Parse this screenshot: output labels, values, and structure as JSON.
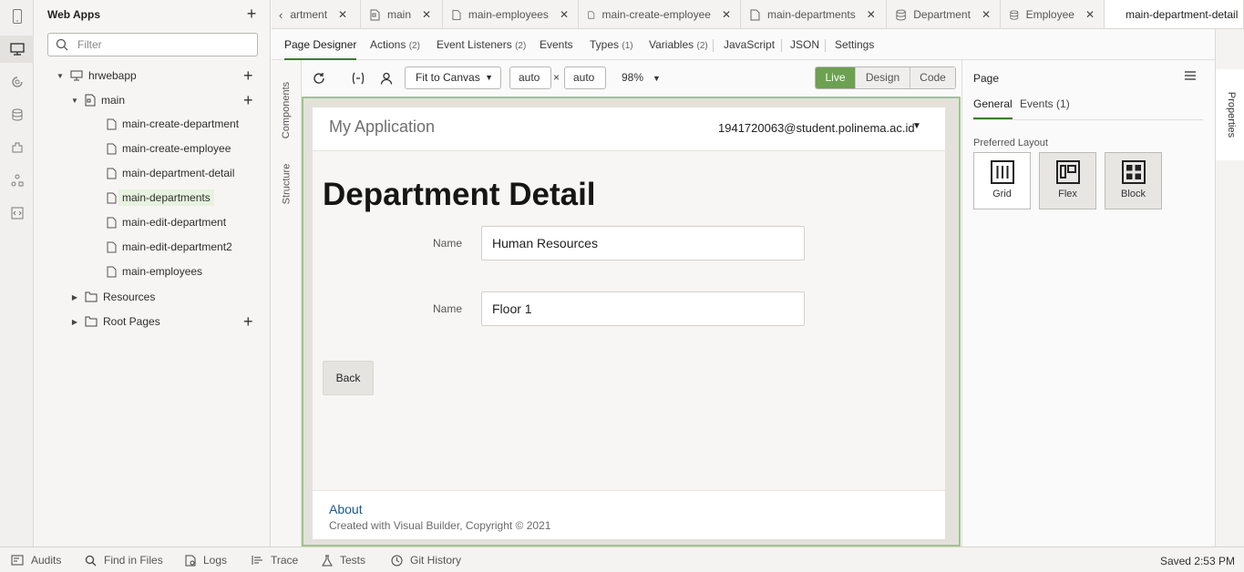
{
  "navigator": {
    "title": "Web Apps",
    "filter_placeholder": "Filter",
    "tree": {
      "app": "hrwebapp",
      "flow": "main",
      "pages": [
        "main-create-department",
        "main-create-employee",
        "main-department-detail",
        "main-departments",
        "main-edit-department",
        "main-edit-department2",
        "main-employees"
      ],
      "selected_page": "main-departments",
      "resources": "Resources",
      "root_pages": "Root Pages"
    }
  },
  "tabs": [
    {
      "label": "artment",
      "icon": "file-icon"
    },
    {
      "label": "main",
      "icon": "flow-icon"
    },
    {
      "label": "main-employees",
      "icon": "file-icon"
    },
    {
      "label": "main-create-employee",
      "icon": "file-icon"
    },
    {
      "label": "main-departments",
      "icon": "file-icon"
    },
    {
      "label": "Department",
      "icon": "database-icon"
    },
    {
      "label": "Employee",
      "icon": "database-icon"
    },
    {
      "label": "main-department-detail",
      "icon": "file-icon",
      "active": true
    }
  ],
  "subtabs": [
    {
      "label": "Page Designer",
      "count": ""
    },
    {
      "label": "Actions",
      "count": "(2)"
    },
    {
      "label": "Event Listeners",
      "count": "(2)"
    },
    {
      "label": "Events",
      "count": ""
    },
    {
      "label": "Types",
      "count": "(1)"
    },
    {
      "label": "Variables",
      "count": "(2)"
    },
    {
      "label": "JavaScript",
      "count": ""
    },
    {
      "label": "JSON",
      "count": ""
    },
    {
      "label": "Settings",
      "count": ""
    }
  ],
  "vtabs": {
    "components": "Components",
    "structure": "Structure"
  },
  "toolbar": {
    "fit": "Fit to Canvas",
    "width": "auto",
    "height": "auto",
    "times": "×",
    "zoom": "98%",
    "modes": [
      "Live",
      "Design",
      "Code"
    ],
    "active_mode": "Live"
  },
  "app_preview": {
    "title": "My Application",
    "user": "1941720063@student.polinema.ac.id",
    "heading": "Department Detail",
    "fields": [
      {
        "label": "Name",
        "value": "Human Resources"
      },
      {
        "label": "Name",
        "value": "Floor 1"
      }
    ],
    "back_button": "Back",
    "footer_link": "About",
    "copyright": "Created with Visual Builder, Copyright © 2021"
  },
  "properties": {
    "title": "Page",
    "tabs": [
      "General",
      "Events (1)"
    ],
    "layout_label": "Preferred Layout",
    "layouts": [
      "Grid",
      "Flex",
      "Block"
    ],
    "selected_layout": "Flex",
    "side_tab": "Properties"
  },
  "status_bar": {
    "items": [
      "Audits",
      "Find in Files",
      "Logs",
      "Trace",
      "Tests",
      "Git History"
    ],
    "saved": "Saved 2:53 PM"
  },
  "colors": {
    "accent": "#6ba150",
    "link": "#1c5a8a",
    "selected_tree": "#e7f2df"
  }
}
